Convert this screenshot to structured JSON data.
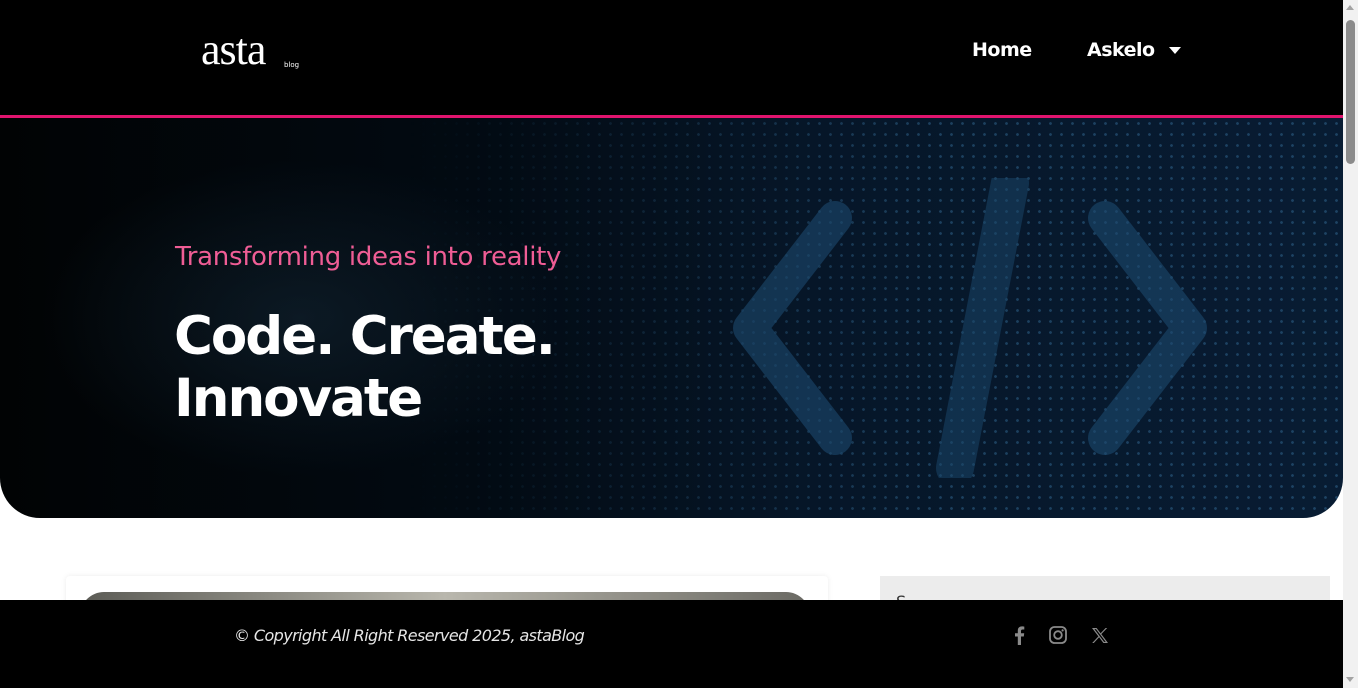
{
  "brand": {
    "logo_text": "asta",
    "logo_sub": "blog"
  },
  "nav": {
    "items": [
      {
        "label": "Home"
      },
      {
        "label": "Askelo",
        "has_dropdown": true
      }
    ]
  },
  "hero": {
    "tagline": "Transforming ideas into reality",
    "title_line1": "Code. Create.",
    "title_line2": "Innovate"
  },
  "sidebar": {
    "label": "S"
  },
  "footer": {
    "copyright": "© Copyright All Right Reserved 2025, astaBlog",
    "social_icons": [
      "facebook-icon",
      "instagram-icon",
      "x-twitter-icon"
    ]
  },
  "colors": {
    "accent": "#e0146e",
    "tagline": "#ef5d95",
    "header_bg": "#000000",
    "footer_bg": "#000000"
  }
}
